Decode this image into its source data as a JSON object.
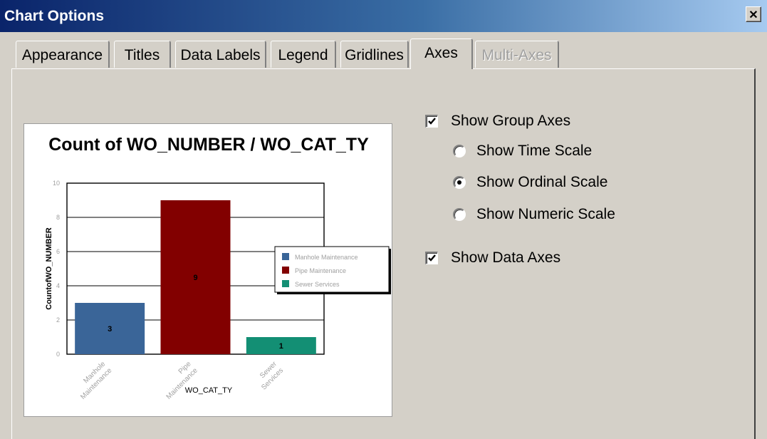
{
  "window": {
    "title": "Chart Options",
    "close_label": "✕"
  },
  "tabs": [
    {
      "label": "Appearance",
      "state": "normal"
    },
    {
      "label": "Titles",
      "state": "normal"
    },
    {
      "label": "Data Labels",
      "state": "normal"
    },
    {
      "label": "Legend",
      "state": "normal"
    },
    {
      "label": "Gridlines",
      "state": "normal"
    },
    {
      "label": "Axes",
      "state": "active"
    },
    {
      "label": "Multi-Axes",
      "state": "disabled"
    }
  ],
  "options": {
    "show_group_axes": {
      "label": "Show Group Axes",
      "checked": true
    },
    "show_time_scale": {
      "label": "Show Time Scale",
      "selected": false
    },
    "show_ordinal_scale": {
      "label": "Show Ordinal Scale",
      "selected": true
    },
    "show_numeric_scale": {
      "label": "Show Numeric Scale",
      "selected": false
    },
    "show_data_axes": {
      "label": "Show Data Axes",
      "checked": true
    }
  },
  "chart_data": {
    "type": "bar",
    "title": "Count of WO_NUMBER / WO_CAT_TY",
    "xlabel": "WO_CAT_TY",
    "ylabel": "CountofWO_NUMBER",
    "categories": [
      "Manhole Maintenance",
      "Pipe Maintenance",
      "Sewer Services"
    ],
    "values": [
      3,
      9,
      1
    ],
    "data_labels": [
      "3",
      "9",
      "1"
    ],
    "colors": [
      "#3a6598",
      "#820000",
      "#138f74"
    ],
    "ylim": [
      0,
      10
    ],
    "yticks": [
      "0",
      "2",
      "4",
      "6",
      "8",
      "10"
    ],
    "legend": {
      "placement": "right",
      "entries": [
        "Manhole Maintenance",
        "Pipe Maintenance",
        "Sewer Services"
      ]
    },
    "grid": true
  }
}
